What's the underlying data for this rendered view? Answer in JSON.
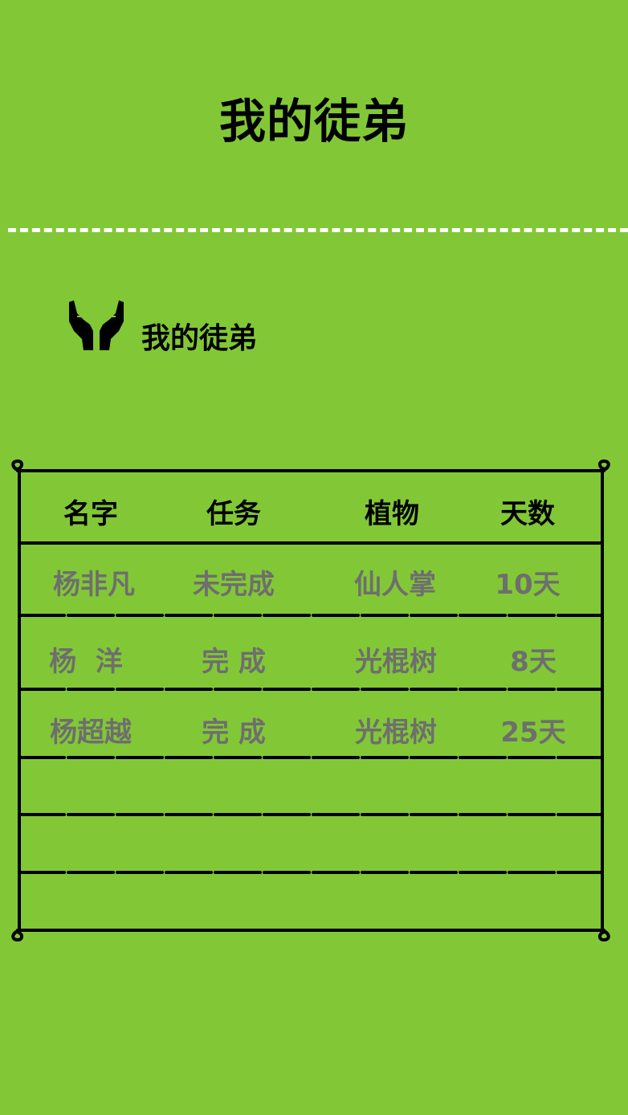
{
  "header": {
    "title": "我的徒弟"
  },
  "section": {
    "label": "我的徒弟",
    "icon": "open-hands-icon"
  },
  "table": {
    "columns": [
      "名字",
      "任务",
      "植物",
      "天数"
    ],
    "rows": [
      {
        "name": "杨非凡",
        "task": "未完成",
        "plant": "仙人掌",
        "days": "10天"
      },
      {
        "name": "杨  洋",
        "task": "完 成",
        "plant": "光棍树",
        "days": "8天"
      },
      {
        "name": "杨超越",
        "task": "完 成",
        "plant": "光棍树",
        "days": "25天"
      }
    ]
  },
  "colors": {
    "background": "#82c836",
    "divider": "#ffffff",
    "ink": "#000000",
    "muted_text": "#6e6e6e"
  }
}
